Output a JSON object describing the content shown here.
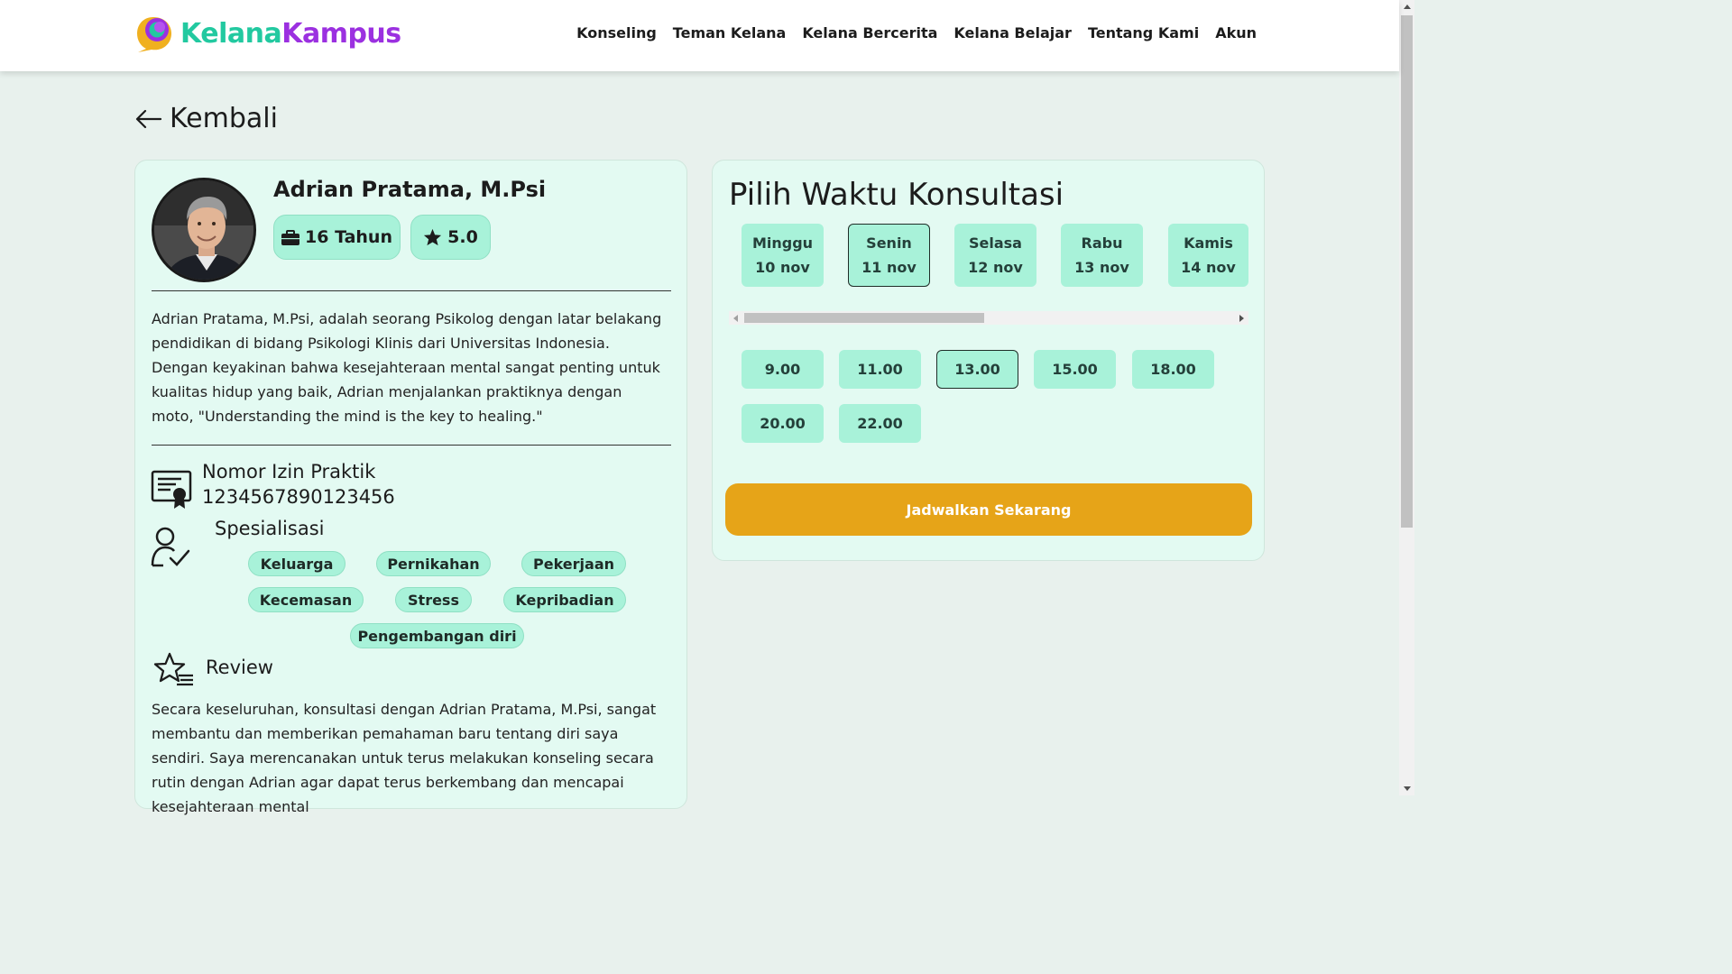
{
  "brand": {
    "part1": "Kelana",
    "part2": "Kampus",
    "color1": "#22c9a0",
    "color2": "#9b30e0"
  },
  "nav": [
    "Konseling",
    "Teman Kelana",
    "Kelana Bercerita",
    "Kelana Belajar",
    "Tentang Kami",
    "Akun"
  ],
  "back_label": "Kembali",
  "profile": {
    "name": "Adrian Pratama, M.Psi",
    "experience": "16 Tahun",
    "rating": "5.0",
    "bio": "Adrian Pratama, M.Psi, adalah seorang Psikolog dengan latar belakang pendidikan di bidang Psikologi Klinis dari Universitas Indonesia. Dengan keyakinan bahwa kesejahteraan mental sangat penting untuk kualitas hidup yang baik, Adrian menjalankan praktiknya dengan moto, \"Understanding the mind is the key to healing.\"",
    "license_label": "Nomor Izin Praktik",
    "license_number": "1234567890123456",
    "specialization_label": "Spesialisasi",
    "specializations": [
      "Keluarga",
      "Pernikahan",
      "Pekerjaan",
      "Kecemasan",
      "Stress",
      "Kepribadian",
      "Pengembangan diri"
    ],
    "review_label": "Review",
    "review_text": "Secara keseluruhan, konsultasi dengan Adrian Pratama, M.Psi, sangat membantu dan memberikan pemahaman baru tentang diri saya sendiri. Saya merencanakan untuk terus melakukan konseling secara rutin dengan Adrian agar dapat terus berkembang dan mencapai kesejahteraan mental"
  },
  "schedule": {
    "title": "Pilih Waktu Konsultasi",
    "days": [
      {
        "day": "Minggu",
        "date": "10 nov"
      },
      {
        "day": "Senin",
        "date": "11 nov"
      },
      {
        "day": "Selasa",
        "date": "12 nov"
      },
      {
        "day": "Rabu",
        "date": "13 nov"
      },
      {
        "day": "Kamis",
        "date": "14 nov"
      }
    ],
    "selected_day": "Senin",
    "times": [
      "9.00",
      "11.00",
      "13.00",
      "15.00",
      "18.00",
      "20.00",
      "22.00"
    ],
    "selected_time": "13.00",
    "cta_label": "Jadwalkan Sekarang",
    "cta_color": "#e6a418"
  }
}
